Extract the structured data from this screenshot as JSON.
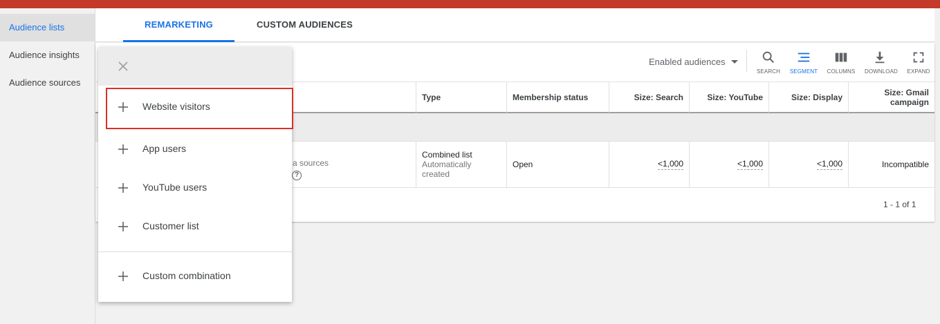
{
  "nav": {
    "items": [
      {
        "label": "Audience lists",
        "active": true
      },
      {
        "label": "Audience insights",
        "active": false
      },
      {
        "label": "Audience sources",
        "active": false
      }
    ]
  },
  "tabs": [
    {
      "label": "REMARKETING",
      "active": true
    },
    {
      "label": "CUSTOM AUDIENCES",
      "active": false
    }
  ],
  "toolbar": {
    "filter_label": "Enabled audiences",
    "tools": [
      "SEARCH",
      "SEGMENT",
      "COLUMNS",
      "DOWNLOAD",
      "EXPAND"
    ]
  },
  "table": {
    "headers": [
      "Type",
      "Membership status",
      "Size: Search",
      "Size: YouTube",
      "Size: Display",
      "Size: Gmail campaign"
    ],
    "row": {
      "sources_text": "a sources",
      "type_main": "Combined list",
      "type_sub": "Automatically created",
      "status": "Open",
      "size_search": "<1,000",
      "size_youtube": "<1,000",
      "size_display": "<1,000",
      "size_gmail": "Incompatible"
    },
    "help_glyph": "?",
    "pagination": "1 - 1 of 1"
  },
  "menu": {
    "items": [
      "Website visitors",
      "App users",
      "YouTube users",
      "Customer list",
      "Custom combination"
    ]
  },
  "colors": {
    "topbar": "#c53929",
    "accent": "#1a73e8",
    "highlight": "#d93025"
  }
}
